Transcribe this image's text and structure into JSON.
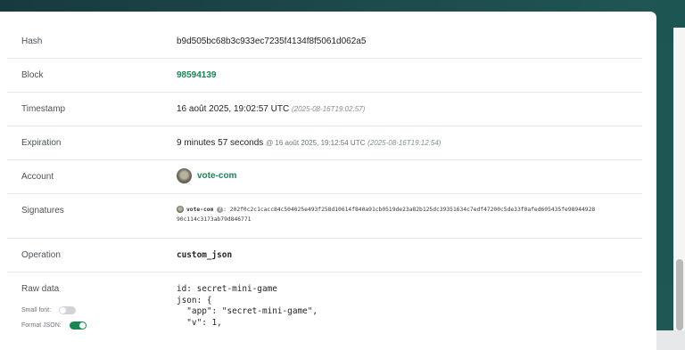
{
  "rows": {
    "hash": {
      "label": "Hash",
      "value": "b9d505bc68b3c933ec7235f4134f8f5061d062a5"
    },
    "block": {
      "label": "Block",
      "value": "98594139"
    },
    "timestamp": {
      "label": "Timestamp",
      "value": "16 août 2025, 19:02:57 UTC",
      "iso": "(2025-08-16T19:02:57)"
    },
    "expiration": {
      "label": "Expiration",
      "relative": "9 minutes 57 seconds",
      "at": "@ 16 août 2025, 19:12:54 UTC",
      "iso": "(2025-08-16T19:12:54)"
    },
    "account": {
      "label": "Account",
      "value": "vote-com"
    },
    "signatures": {
      "label": "Signatures",
      "account": "vote-com",
      "separator": ":",
      "line1": "202f0c2c1cacc84c504025e493f258d10614f840a91cb0519de23a82b125dc39351634c7edf47200c5de33f0afed605435fe98944928",
      "line2": "90c114c3173ab79d846771"
    },
    "operation": {
      "label": "Operation",
      "value": "custom_json"
    },
    "raw_data": {
      "label": "Raw data",
      "small_font_label": "Small font:",
      "small_font_on": false,
      "format_json_label": "Format JSON:",
      "format_json_on": true,
      "line1": "id: secret-mini-game",
      "line2": "json: {",
      "line3": "  \"app\": \"secret-mini-game\",",
      "line4": "  \"v\": 1,"
    }
  },
  "colors": {
    "link": "#198754",
    "toggle_on": "#198754",
    "toggle_off": "#d0d4d8",
    "header": "#173a3f"
  }
}
